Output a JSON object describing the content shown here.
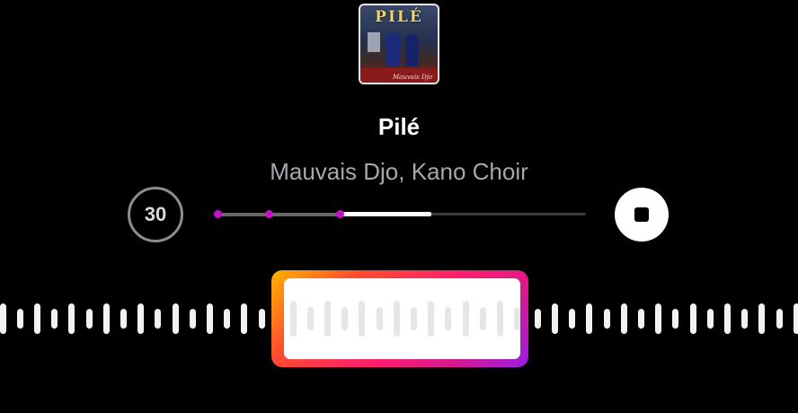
{
  "album": {
    "art_title": "PILÉ",
    "art_signature": "Mauvais Djo"
  },
  "track": {
    "title": "Pilé",
    "artist": "Mauvais Djo, Kano Choir"
  },
  "controls": {
    "skip_label": "30",
    "skip_icon": "rewind-30-icon",
    "stop_icon": "stop-icon"
  },
  "progress": {
    "position_fraction": 0.58,
    "markers": 3
  },
  "colors": {
    "background": "#000000",
    "marker": "#c613c9",
    "selector_gradient": [
      "#ffb300",
      "#ff1f6e",
      "#9b1de6"
    ]
  }
}
